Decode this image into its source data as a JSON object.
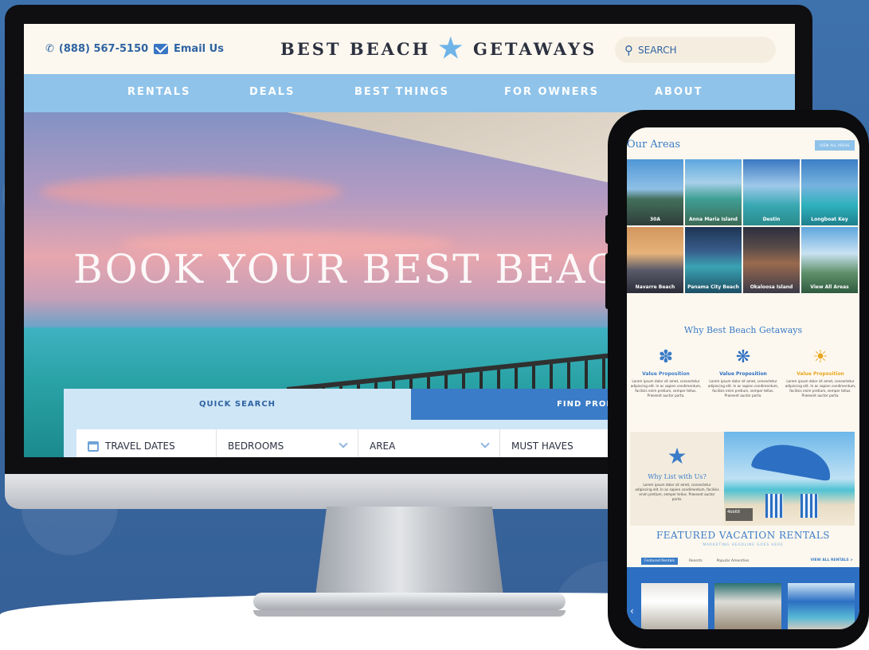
{
  "desktop": {
    "topbar": {
      "phone": "(888) 567-5150",
      "email": "Email Us",
      "logo_left": "BEST BEACH",
      "logo_right": "GETAWAYS",
      "search_placeholder": "SEARCH"
    },
    "nav": [
      "RENTALS",
      "DEALS",
      "BEST THINGS",
      "FOR OWNERS",
      "ABOUT"
    ],
    "hero": {
      "title": "BOOK YOUR BEST BEACH GE"
    },
    "quick_search": {
      "tab_active": "QUICK SEARCH",
      "tab_other": "FIND PROPERTY B",
      "fields": [
        "TRAVEL DATES",
        "BEDROOMS",
        "AREA",
        "MUST HAVES"
      ]
    }
  },
  "mobile": {
    "areas": {
      "title": "Our Areas",
      "view_all": "VIEW ALL AREAS",
      "tiles": [
        "30A",
        "Anna Maria Island",
        "Destin",
        "Longboat Key",
        "Navarre Beach",
        "Panama City Beach",
        "Okaloosa Island",
        "View All Areas"
      ]
    },
    "why": {
      "title": "Why Best Beach Getaways",
      "items": [
        {
          "title": "Value Proposition",
          "text": "Lorem ipsum dolor sit amet, consectetur adipiscing elit. In ac sapien condimentum, facilisis enim pretium, semper tellus. Praesent auctor porta.",
          "color": "#3a7cc7"
        },
        {
          "title": "Value Proposition",
          "text": "Lorem ipsum dolor sit amet, consectetur adipiscing elit. In ac sapien condimentum, facilisis enim pretium, semper tellus. Praesent auctor porta.",
          "color": "#2c6fc3"
        },
        {
          "title": "Value Proposition",
          "text": "Lorem ipsum dolor sit amet, consectetur adipiscing elit. In ac sapien condimentum, facilisis enim pretium, semper tellus. Praesent auctor porta.",
          "color": "#e7a61f"
        }
      ]
    },
    "list": {
      "title": "Why List with Us?",
      "text": "Lorem ipsum dolor sit amet, consectetur adipiscing elit. In ac sapien condimentum, facilisis enim pretium, semper tellus. Praesent auctor porta.",
      "badge": "4bb68"
    },
    "featured": {
      "title": "FEATURED VACATION RENTALS",
      "subtitle": "MARKETING HEADLINE GOES HERE",
      "tabs": [
        "Featured Rentals",
        "Resorts",
        "Popular Amenities"
      ],
      "view_all": "VIEW ALL RENTALS >"
    }
  },
  "colors": {
    "accent": "#3a7cc7",
    "nav_bg": "#8fc3ea",
    "cream": "#fdf8ef"
  }
}
